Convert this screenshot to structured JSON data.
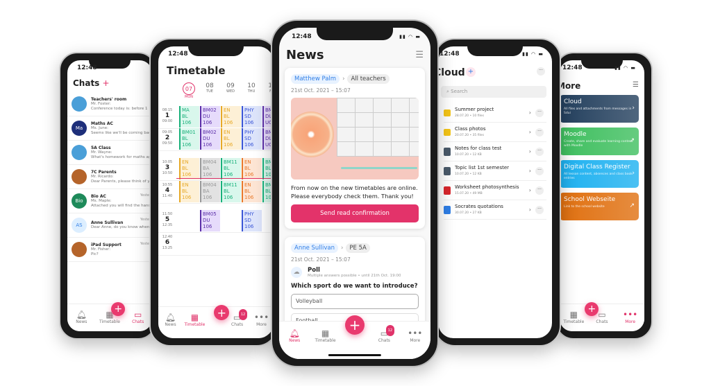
{
  "status_time": "12:48",
  "chats": {
    "title": "Chats",
    "items": [
      {
        "name": "Teachers' room",
        "sender": "Mr. Foster:",
        "msg": "Conference today is: before 1",
        "avatar": "group",
        "color": "#4a9fd8"
      },
      {
        "name": "Maths AC",
        "sender": "Ms. June:",
        "msg": "Seems like we'll be coming back 5 min...",
        "avatar": "Ma",
        "color": "#1e2f7a"
      },
      {
        "name": "5A Class",
        "sender": "Mr. Wayne:",
        "msg": "What's homework for maths again?",
        "avatar": "group",
        "color": "#4a9fd8"
      },
      {
        "name": "7C Parents",
        "sender": "Mr. Ricardo:",
        "msg": "Dear Parents, please think of your form...",
        "avatar": "photo",
        "color": "#b5642a"
      },
      {
        "name": "Bio AC",
        "sender": "Ms. Maple:",
        "msg": "Attached you will find the handout for...",
        "avatar": "Bio",
        "color": "#1e8a5a",
        "time": "Yeste"
      },
      {
        "name": "Anne Sullivan",
        "sender": "",
        "msg": "Dear Anne, do you know when you will be on meet time with 5A?",
        "avatar": "AS",
        "color": "#dceeff",
        "time": "Yeste"
      },
      {
        "name": "iPad Support",
        "sender": "Mr. Fisher:",
        "msg": "Pic?",
        "avatar": "photo",
        "color": "#b5642a",
        "time": "Yeste"
      }
    ],
    "tabs": [
      "News",
      "Timetable",
      "Chats"
    ]
  },
  "timetable": {
    "title": "Timetable",
    "days": [
      {
        "num": "07",
        "name": "MON"
      },
      {
        "num": "08",
        "name": "TUE"
      },
      {
        "num": "09",
        "name": "WED"
      },
      {
        "num": "10",
        "name": "THU"
      },
      {
        "num": "11",
        "name": "FRI"
      }
    ],
    "periods": [
      {
        "n": "1",
        "start": "08:15",
        "end": "09:00"
      },
      {
        "n": "2",
        "start": "09:05",
        "end": "09:50"
      },
      {
        "n": "3",
        "start": "10:05",
        "end": "10:50"
      },
      {
        "n": "4",
        "start": "10:55",
        "end": "11:40"
      },
      {
        "n": "5",
        "start": "11:50",
        "end": "12:35"
      },
      {
        "n": "6",
        "start": "12:40",
        "end": "13:25"
      }
    ],
    "lessons": [
      {
        "p": 0,
        "d": 0,
        "s": "MA",
        "t": "BL",
        "r": "106",
        "c": "#19b07a",
        "bg": "#d9f7ec"
      },
      {
        "p": 0,
        "d": 1,
        "s": "BM02",
        "t": "DU",
        "r": "106",
        "c": "#5b2fa8",
        "bg": "#e6dbfb"
      },
      {
        "p": 0,
        "d": 2,
        "s": "EN",
        "t": "BL",
        "r": "106",
        "c": "#e7a928",
        "bg": "#fdf0d6"
      },
      {
        "p": 0,
        "d": 3,
        "s": "PHY",
        "t": "SD",
        "r": "106",
        "c": "#3a56d6",
        "bg": "#dde4fb"
      },
      {
        "p": 0,
        "d": 4,
        "s": "BM",
        "t": "DU",
        "r": "UG",
        "c": "#5b2fa8",
        "bg": "#e6dbfb"
      },
      {
        "p": 1,
        "d": 0,
        "s": "BM01",
        "t": "BL",
        "r": "106",
        "c": "#19b07a",
        "bg": "#d9f7ec"
      },
      {
        "p": 1,
        "d": 1,
        "s": "BM02",
        "t": "DU",
        "r": "106",
        "c": "#5b2fa8",
        "bg": "#e6dbfb"
      },
      {
        "p": 1,
        "d": 2,
        "s": "EN",
        "t": "BL",
        "r": "106",
        "c": "#e7a928",
        "bg": "#fdf0d6"
      },
      {
        "p": 1,
        "d": 3,
        "s": "PHY",
        "t": "SD",
        "r": "106",
        "c": "#3a56d6",
        "bg": "#dde4fb"
      },
      {
        "p": 1,
        "d": 4,
        "s": "BM",
        "t": "DU",
        "r": "UG",
        "c": "#5b2fa8",
        "bg": "#e6dbfb"
      },
      {
        "p": 2,
        "d": 0,
        "s": "EN",
        "t": "BL",
        "r": "106",
        "c": "#e7a928",
        "bg": "#fdf0d6"
      },
      {
        "p": 2,
        "d": 1,
        "s": "BM04",
        "t": "BA",
        "r": "106",
        "c": "#999",
        "bg": "#e2e2e2"
      },
      {
        "p": 2,
        "d": 2,
        "s": "BM11",
        "t": "BL",
        "r": "106",
        "c": "#19b07a",
        "bg": "#d9f7ec"
      },
      {
        "p": 2,
        "d": 3,
        "s": "EN",
        "t": "BL",
        "r": "106",
        "c": "#e8792a",
        "bg": "#fde5d4"
      },
      {
        "p": 2,
        "d": 4,
        "s": "BM",
        "t": "BL",
        "r": "106",
        "c": "#19b07a",
        "bg": "#d9f7ec"
      },
      {
        "p": 3,
        "d": 0,
        "s": "EN",
        "t": "BL",
        "r": "106",
        "c": "#e7a928",
        "bg": "#fdf0d6"
      },
      {
        "p": 3,
        "d": 1,
        "s": "BM04",
        "t": "BA",
        "r": "106",
        "c": "#999",
        "bg": "#e2e2e2"
      },
      {
        "p": 3,
        "d": 2,
        "s": "BM11",
        "t": "BL",
        "r": "106",
        "c": "#19b07a",
        "bg": "#d9f7ec"
      },
      {
        "p": 3,
        "d": 3,
        "s": "EN",
        "t": "BL",
        "r": "106",
        "c": "#e8792a",
        "bg": "#fde5d4"
      },
      {
        "p": 3,
        "d": 4,
        "s": "BM",
        "t": "BL",
        "r": "106",
        "c": "#19b07a",
        "bg": "#d9f7ec"
      },
      {
        "p": 4,
        "d": 1,
        "s": "BM05",
        "t": "DU",
        "r": "106",
        "c": "#5b2fa8",
        "bg": "#e6dbfb"
      },
      {
        "p": 4,
        "d": 3,
        "s": "PHY",
        "t": "SD",
        "r": "106",
        "c": "#3a56d6",
        "bg": "#dde4fb"
      }
    ],
    "tabs": [
      "News",
      "Timetable",
      "Chats",
      "More"
    ],
    "chats_badge": "12"
  },
  "news": {
    "title": "News",
    "post1": {
      "author": "Matthew Palm",
      "audience": "All teachers",
      "date": "21st Oct. 2021 – 15:07",
      "text": "From now on the new timetables are online. Please everybody check them. Thank you!",
      "button": "Send read confirmation"
    },
    "post2": {
      "author": "Anne Sullivan",
      "audience": "PE 5A",
      "date": "21st Oct. 2021 – 15:07",
      "poll_label": "Poll",
      "poll_meta": "Multiple answers possible • until 21th Oct. 19:00",
      "question": "Which sport do we want to introduce?",
      "options": [
        "Volleyball",
        "Football"
      ]
    },
    "tabs": [
      "News",
      "Timetable",
      "Chats",
      "More"
    ],
    "chats_badge": "12"
  },
  "cloud": {
    "title": "Cloud",
    "search_placeholder": "Search",
    "files": [
      {
        "name": "Summer project",
        "meta": "28.07.20 • 10 files",
        "type": "folder",
        "color": "#f5c518"
      },
      {
        "name": "Class photos",
        "meta": "20.07.20 • 35 files",
        "type": "folder",
        "color": "#f5c518"
      },
      {
        "name": "Notes for class test",
        "meta": "10.07.20 • 12 KB",
        "type": "text",
        "color": "#4a5a6a"
      },
      {
        "name": "Topic list 1st semester",
        "meta": "10.07.20 • 12 KB",
        "type": "text",
        "color": "#4a5a6a"
      },
      {
        "name": "Worksheet photosynthesis",
        "meta": "15.07.20 • 49 MB",
        "type": "pdf",
        "color": "#d9262c"
      },
      {
        "name": "Socrates quotations",
        "meta": "30.07.20 • 27 KB",
        "type": "doc",
        "color": "#2f7ee6"
      }
    ]
  },
  "more": {
    "title": "More",
    "cards": [
      {
        "title": "Cloud",
        "desc": "All files and attachments from messages in Sdui",
        "color": "#24405e",
        "icon": "chevron-right"
      },
      {
        "title": "Moodle",
        "desc": "Create, share and evaluate learning content with Moodle",
        "color": "#3fbf5f",
        "icon": "external-link"
      },
      {
        "title": "Digital Class Register",
        "desc": "All lesson content, absences and class book entries",
        "color": "#1eb1f0",
        "icon": "chevron-right"
      },
      {
        "title": "School Webseite",
        "desc": "Link to the school website",
        "color": "#e07010",
        "icon": "external-link"
      }
    ],
    "tabs": [
      "Timetable",
      "Chats",
      "More"
    ]
  },
  "accent": "#e3336a"
}
